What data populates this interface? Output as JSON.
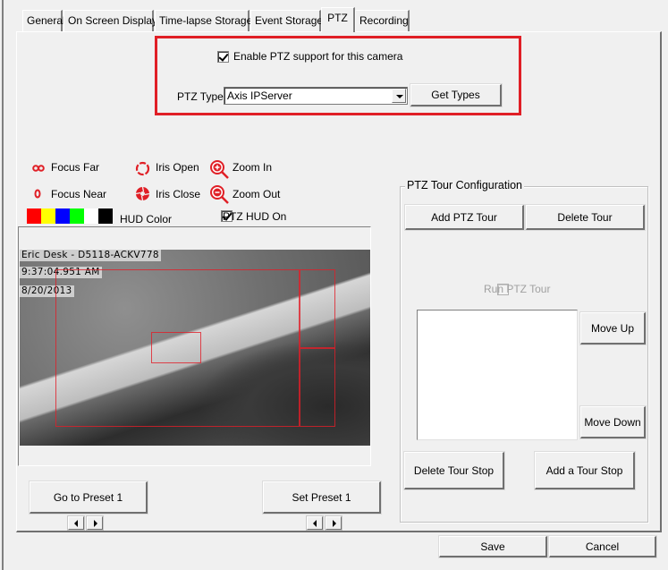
{
  "tabs": [
    {
      "label": "General",
      "active": false
    },
    {
      "label": "On Screen Display",
      "active": false
    },
    {
      "label": "Time-lapse Storage",
      "active": false
    },
    {
      "label": "Event Storage",
      "active": false
    },
    {
      "label": "PTZ",
      "active": true
    },
    {
      "label": "Recording",
      "active": false
    }
  ],
  "ptz": {
    "enable_label": "Enable PTZ support for this camera",
    "enable_checked": true,
    "type_label": "PTZ Type:",
    "type_value": "Axis IPServer",
    "get_types_label": "Get Types"
  },
  "controls": {
    "focus_far": "Focus Far",
    "focus_near": "Focus Near",
    "iris_open": "Iris Open",
    "iris_close": "Iris Close",
    "zoom_in": "Zoom In",
    "zoom_out": "Zoom Out",
    "hud_color_label": "HUD Color",
    "hud_colors": [
      "#ff0000",
      "#ffff00",
      "#0000ff",
      "#00ff00",
      "#ffffff",
      "#000000"
    ],
    "hud_on_label": "PTZ HUD On",
    "hud_on_checked": true,
    "accent_color": "#e01f26"
  },
  "video": {
    "camera_name": "Eric Desk - D5118-ACKV778",
    "time": "9:37:04.951 AM",
    "date": "8/20/2013"
  },
  "presets": {
    "goto_label": "Go to Preset 1",
    "set_label": "Set Preset 1"
  },
  "tour": {
    "title": "PTZ Tour Configuration",
    "add_tour": "Add PTZ Tour",
    "delete_tour": "Delete Tour",
    "run_tour": "Run PTZ Tour",
    "run_tour_checked": false,
    "move_up": "Move Up",
    "move_down": "Move Down",
    "delete_stop": "Delete Tour Stop",
    "add_stop": "Add a Tour Stop",
    "stops": []
  },
  "footer": {
    "save": "Save",
    "cancel": "Cancel"
  }
}
